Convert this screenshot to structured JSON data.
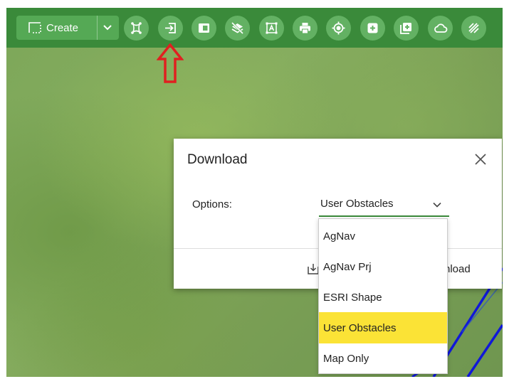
{
  "toolbar": {
    "create_label": "Create",
    "buttons": [
      "polygon-select-icon",
      "import-icon",
      "panel-icon",
      "layers-off-icon",
      "text-box-icon",
      "print-icon",
      "gps-locate-icon",
      "add-square-icon",
      "add-copy-icon",
      "cloud-icon",
      "hatch-icon"
    ]
  },
  "colors": {
    "toolbar_bg": "#3a8a3a",
    "button_bg": "#63b163",
    "arrow": "#e02020",
    "selected_item": "#fbe336",
    "map_line": "#1018d8"
  },
  "dialog": {
    "title": "Download",
    "options_label": "Options:",
    "selected_option": "User Obstacles",
    "download_label": "nload"
  },
  "dropdown": {
    "items": [
      "AgNav",
      "AgNav Prj",
      "ESRI Shape",
      "User Obstacles",
      "Map Only"
    ],
    "selected_index": 3
  }
}
